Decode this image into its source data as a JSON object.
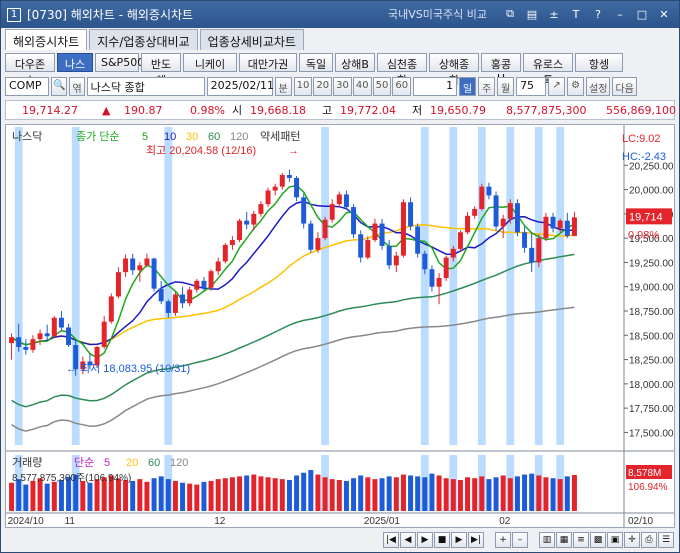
{
  "window": {
    "number": "1",
    "title": "[0730] 해외차트 - 해외증시차트",
    "compare_label": "국내VS미국주식 비교",
    "icons": [
      "link-icon",
      "chart-icon",
      "plus-minus-icon",
      "text-icon",
      "help-icon",
      "minimize-icon",
      "maximize-icon",
      "close-icon"
    ]
  },
  "tabs": [
    "해외증시차트",
    "지수/업종상대비교",
    "업종상세비교차트"
  ],
  "markets": [
    "다우존스",
    "나스닥",
    "S&P500",
    "반도체",
    "니케이",
    "대만가권",
    "독일",
    "상해B",
    "심천종합",
    "상해종합",
    "홍콩H",
    "유로스톡",
    "항셍"
  ],
  "selected_market": "나스닥",
  "controls": {
    "code": "COMP",
    "name": "나스닥 종합",
    "date": "2025/02/11",
    "period_unit": "분",
    "minute_options": [
      "10",
      "20",
      "30",
      "40",
      "50",
      "60"
    ],
    "count": "1",
    "period_buttons": [
      "일",
      "주",
      "월"
    ],
    "selected_period": "일",
    "bars": "75",
    "settings": "설정",
    "next": "다음",
    "lock_label": "엮"
  },
  "quote": {
    "last": "19,714.27",
    "arrow": "▲",
    "change": "190.87",
    "pct": "0.98%",
    "open_label": "시",
    "open": "19,668.18",
    "high_label": "고",
    "high": "19,772.04",
    "low_label": "저",
    "low": "19,650.79",
    "volume": "8,577,875,300",
    "amount": "556,869,100"
  },
  "chart_legend": {
    "name": "나스닥",
    "ma_label": "종가 단순",
    "periods": [
      "5",
      "10",
      "30",
      "60",
      "120"
    ],
    "pattern": "약세패턴",
    "lc": "LC:9.02",
    "hc": "HC:-2.43",
    "last_badge": "19,714",
    "pct_badge": "0.98%",
    "max_label": "최고 20,204.58 (12/16)",
    "min_label": "최저 18,083.95 (10/31)"
  },
  "volume_legend": {
    "label": "거래량",
    "ma_label": "단순",
    "periods": [
      "5",
      "20",
      "60",
      "120"
    ],
    "value": "8,577,875,300주(106.94%)",
    "badge_value": "8,578M",
    "badge_pct": "106.94%"
  },
  "x_labels": [
    {
      "t": "2024/10",
      "i": 0
    },
    {
      "t": "11",
      "i": 8
    },
    {
      "t": "12",
      "i": 29
    },
    {
      "t": "2025/01",
      "i": 50
    },
    {
      "t": "02",
      "i": 69
    },
    {
      "t": "02/10",
      "i": 80
    }
  ],
  "chart_data": {
    "type": "candlestick",
    "ylim": [
      17350,
      20500
    ],
    "y_ticks": [
      17500,
      17750,
      18000,
      18250,
      18500,
      18750,
      19000,
      19250,
      19500,
      19750,
      20000,
      20250
    ],
    "y_tick_labels": [
      "17,500.00",
      "17,750.00",
      "18,000.00",
      "18,250.00",
      "18,500.00",
      "18,750.00",
      "19,000.00",
      "19,250.00",
      "19,500.00",
      "19,750.00",
      "20,000.00",
      "20,250.00"
    ],
    "candles": [
      [
        18420,
        18520,
        18250,
        18480
      ],
      [
        18480,
        18620,
        18330,
        18380
      ],
      [
        18380,
        18460,
        18300,
        18350
      ],
      [
        18350,
        18500,
        18320,
        18460
      ],
      [
        18460,
        18560,
        18400,
        18520
      ],
      [
        18520,
        18610,
        18440,
        18490
      ],
      [
        18490,
        18700,
        18470,
        18680
      ],
      [
        18680,
        18750,
        18550,
        18580
      ],
      [
        18580,
        18620,
        18380,
        18400
      ],
      [
        18400,
        18450,
        18083,
        18150
      ],
      [
        18150,
        18280,
        18100,
        18230
      ],
      [
        18230,
        18310,
        18150,
        18190
      ],
      [
        18190,
        18390,
        18170,
        18380
      ],
      [
        18380,
        18700,
        18360,
        18640
      ],
      [
        18640,
        18930,
        18620,
        18900
      ],
      [
        18900,
        19200,
        18880,
        19150
      ],
      [
        19150,
        19330,
        19100,
        19290
      ],
      [
        19290,
        19340,
        19120,
        19170
      ],
      [
        19170,
        19250,
        19050,
        19220
      ],
      [
        19220,
        19340,
        19200,
        19290
      ],
      [
        19290,
        19300,
        18950,
        18980
      ],
      [
        18980,
        19060,
        18820,
        18850
      ],
      [
        18850,
        18870,
        18680,
        18730
      ],
      [
        18730,
        18950,
        18700,
        18920
      ],
      [
        18920,
        19000,
        18780,
        18830
      ],
      [
        18830,
        19000,
        18800,
        18970
      ],
      [
        18970,
        19080,
        18940,
        19060
      ],
      [
        19060,
        19100,
        18960,
        18990
      ],
      [
        18990,
        19180,
        18960,
        19160
      ],
      [
        19160,
        19300,
        19120,
        19260
      ],
      [
        19260,
        19450,
        19240,
        19430
      ],
      [
        19430,
        19520,
        19380,
        19480
      ],
      [
        19480,
        19700,
        19460,
        19680
      ],
      [
        19680,
        19770,
        19590,
        19640
      ],
      [
        19640,
        19780,
        19580,
        19750
      ],
      [
        19750,
        19880,
        19720,
        19850
      ],
      [
        19850,
        20020,
        19820,
        19990
      ],
      [
        19990,
        20060,
        19940,
        20030
      ],
      [
        20030,
        20170,
        20000,
        20150
      ],
      [
        20150,
        20204,
        20080,
        20120
      ],
      [
        20120,
        20140,
        19880,
        19920
      ],
      [
        19920,
        19960,
        19600,
        19650
      ],
      [
        19650,
        19680,
        19350,
        19380
      ],
      [
        19380,
        19560,
        19350,
        19500
      ],
      [
        19500,
        19720,
        19480,
        19690
      ],
      [
        19690,
        19900,
        19660,
        19850
      ],
      [
        19850,
        19980,
        19820,
        19950
      ],
      [
        19950,
        19990,
        19790,
        19820
      ],
      [
        19820,
        19850,
        19500,
        19540
      ],
      [
        19540,
        19580,
        19250,
        19300
      ],
      [
        19300,
        19520,
        19280,
        19480
      ],
      [
        19480,
        19700,
        19460,
        19650
      ],
      [
        19650,
        19700,
        19380,
        19420
      ],
      [
        19420,
        19480,
        19180,
        19220
      ],
      [
        19220,
        19360,
        19150,
        19320
      ],
      [
        19320,
        19900,
        19300,
        19870
      ],
      [
        19870,
        19920,
        19580,
        19620
      ],
      [
        19620,
        19650,
        19300,
        19340
      ],
      [
        19340,
        19370,
        19130,
        19180
      ],
      [
        19180,
        19220,
        18950,
        19000
      ],
      [
        19000,
        19140,
        18820,
        19090
      ],
      [
        19090,
        19320,
        19060,
        19300
      ],
      [
        19300,
        19420,
        19260,
        19390
      ],
      [
        19390,
        19580,
        19360,
        19560
      ],
      [
        19560,
        19770,
        19540,
        19730
      ],
      [
        19730,
        19830,
        19700,
        19800
      ],
      [
        19800,
        20060,
        19780,
        20030
      ],
      [
        20030,
        20070,
        19900,
        19940
      ],
      [
        19940,
        19980,
        19580,
        19620
      ],
      [
        19620,
        19740,
        19500,
        19700
      ],
      [
        19700,
        19900,
        19650,
        19860
      ],
      [
        19860,
        19900,
        19520,
        19560
      ],
      [
        19560,
        19620,
        19350,
        19400
      ],
      [
        19400,
        19560,
        19150,
        19250
      ],
      [
        19250,
        19540,
        19200,
        19500
      ],
      [
        19500,
        19760,
        19470,
        19720
      ],
      [
        19720,
        19760,
        19560,
        19600
      ],
      [
        19600,
        19700,
        19560,
        19680
      ],
      [
        19680,
        19760,
        19500,
        19523
      ],
      [
        19523,
        19772,
        19520,
        19714
      ]
    ],
    "volume": [
      62,
      70,
      58,
      66,
      72,
      60,
      64,
      68,
      75,
      80,
      66,
      62,
      70,
      74,
      78,
      72,
      68,
      66,
      70,
      64,
      72,
      76,
      70,
      66,
      62,
      60,
      58,
      64,
      66,
      70,
      72,
      74,
      76,
      78,
      80,
      76,
      74,
      72,
      70,
      68,
      78,
      84,
      90,
      80,
      74,
      70,
      68,
      66,
      72,
      78,
      74,
      70,
      72,
      76,
      74,
      80,
      78,
      76,
      74,
      82,
      78,
      72,
      70,
      68,
      74,
      72,
      76,
      70,
      74,
      78,
      72,
      76,
      80,
      82,
      78,
      74,
      72,
      70,
      76,
      79
    ],
    "highlight_bands": [
      1,
      9,
      22,
      44,
      58,
      62,
      66,
      70,
      74,
      77
    ],
    "series_colors": {
      "ma5": "#1ca81c",
      "ma10": "#1a1ac8",
      "ma30": "#ffc000",
      "ma60": "#2e8b57",
      "ma120": "#888888"
    }
  }
}
